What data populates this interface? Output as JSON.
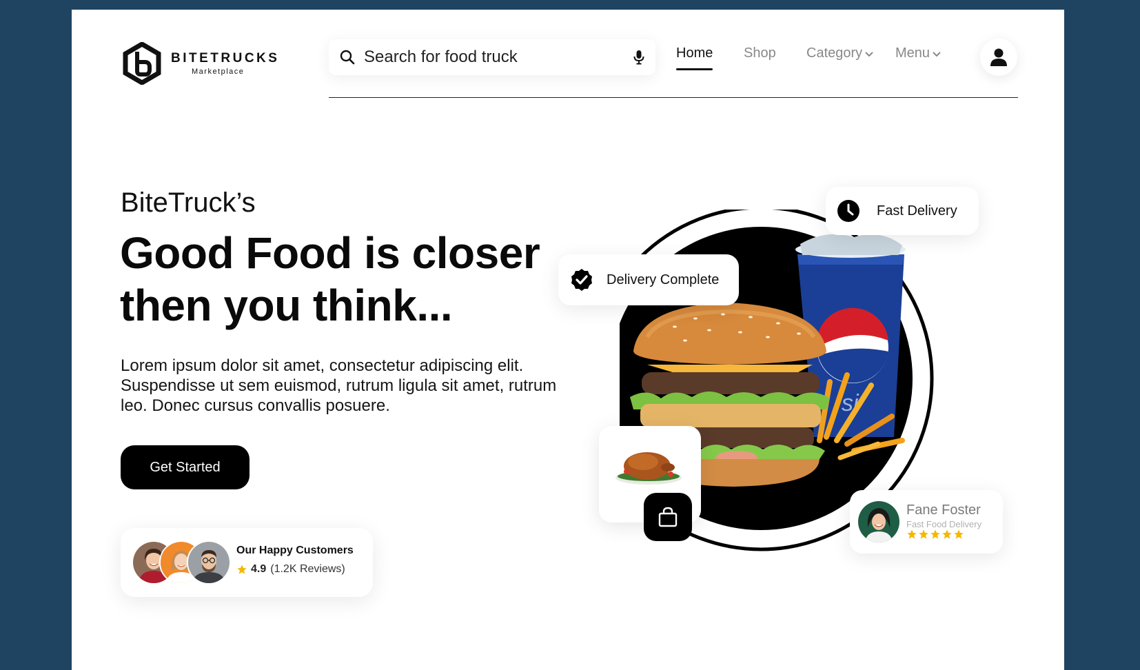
{
  "brand": {
    "name": "BITETRUCKS",
    "tagline": "Marketplace"
  },
  "search": {
    "placeholder": "Search for food truck",
    "search_icon": "search-icon",
    "mic_icon": "microphone-icon"
  },
  "nav": {
    "items": [
      {
        "label": "Home",
        "active": true
      },
      {
        "label": "Shop",
        "active": false
      },
      {
        "label": "Category",
        "active": false,
        "dropdown": true
      },
      {
        "label": "Menu",
        "active": false,
        "dropdown": true
      }
    ],
    "user_icon": "user-icon"
  },
  "hero": {
    "eyebrow": "BiteTruck’s",
    "headline_line1": "Good Food is closer",
    "headline_line2": "then you think...",
    "description": "Lorem ipsum dolor sit amet, consectetur adipiscing elit. Suspendisse ut sem euismod, rutrum ligula sit amet, rutrum leo. Donec cursus convallis posuere.",
    "cta_label": "Get Started"
  },
  "customers": {
    "title": "Our Happy Customers",
    "rating": "4.9",
    "reviews": "(1.2K Reviews)"
  },
  "badges": {
    "fast_delivery": "Fast Delivery",
    "delivery_complete": "Delivery Complete"
  },
  "review": {
    "name": "Fane Foster",
    "role": "Fast Food Delivery",
    "stars": 5
  },
  "colors": {
    "background": "#1f4461",
    "accent": "#000000",
    "star": "#f5b800"
  }
}
